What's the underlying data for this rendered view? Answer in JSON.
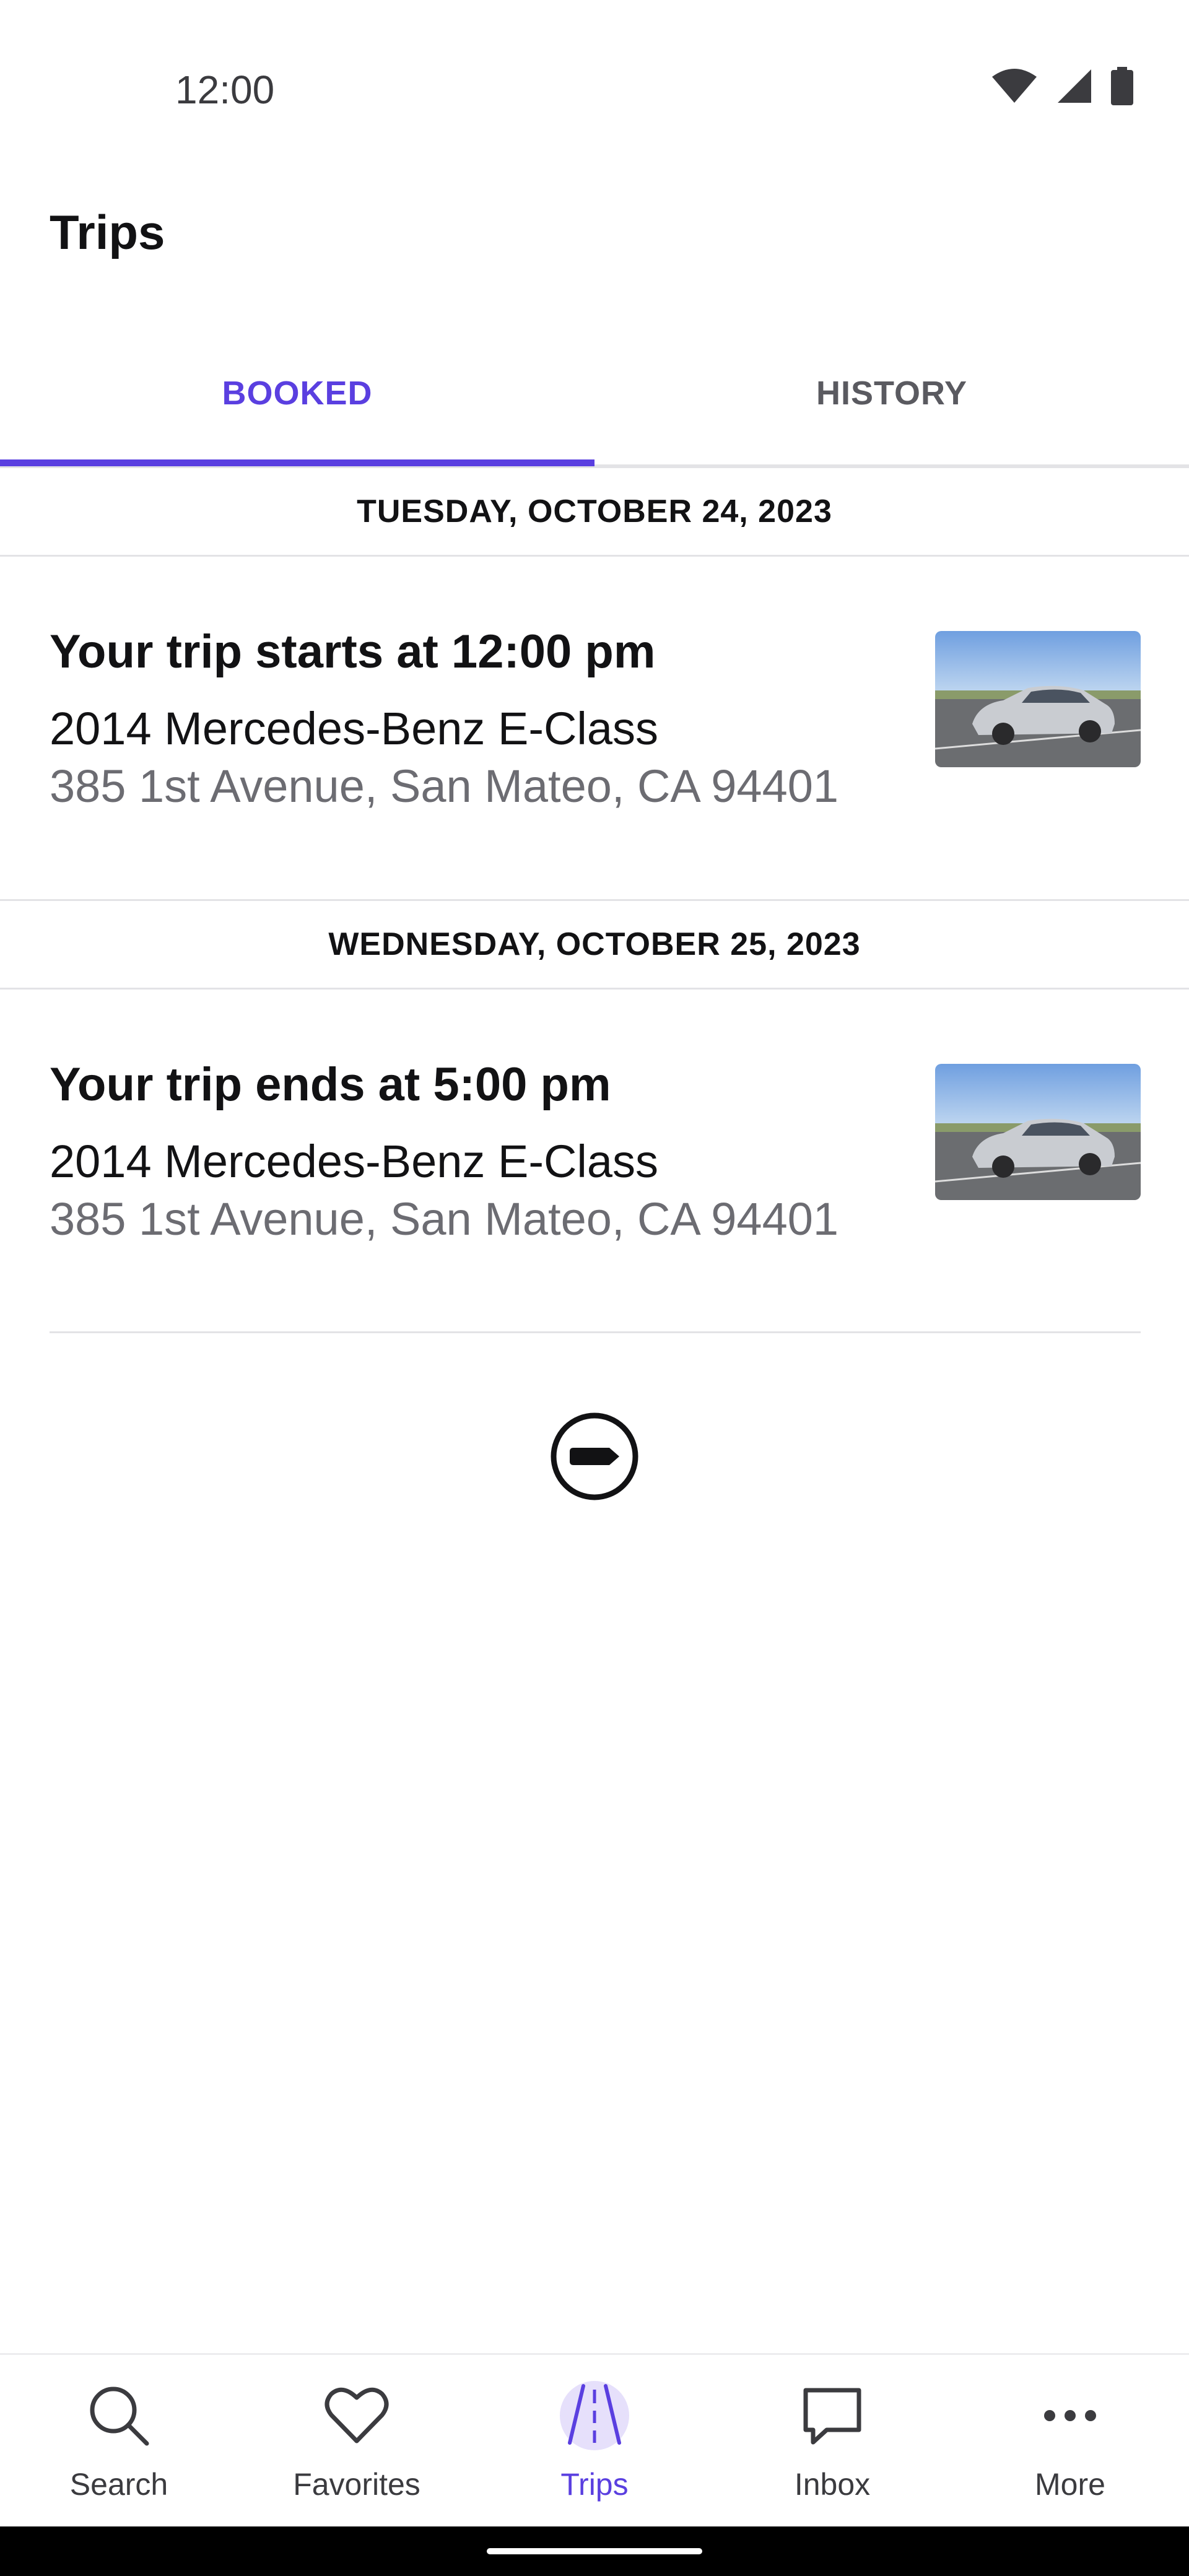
{
  "status_bar": {
    "time": "12:00"
  },
  "header": {
    "title": "Trips"
  },
  "tabs": [
    {
      "label": "BOOKED",
      "active": true
    },
    {
      "label": "HISTORY",
      "active": false
    }
  ],
  "trips": [
    {
      "date": "TUESDAY, OCTOBER 24, 2023",
      "title": "Your trip starts at 12:00 pm",
      "vehicle": "2014 Mercedes-Benz E-Class",
      "address": "385 1st Avenue, San Mateo, CA 94401"
    },
    {
      "date": "WEDNESDAY, OCTOBER 25, 2023",
      "title": "Your trip ends at 5:00 pm",
      "vehicle": "2014 Mercedes-Benz E-Class",
      "address": "385 1st Avenue, San Mateo, CA 94401"
    }
  ],
  "nav": [
    {
      "label": "Search",
      "icon": "search-icon"
    },
    {
      "label": "Favorites",
      "icon": "heart-icon"
    },
    {
      "label": "Trips",
      "icon": "road-icon",
      "active": true
    },
    {
      "label": "Inbox",
      "icon": "chat-icon"
    },
    {
      "label": "More",
      "icon": "more-icon"
    }
  ],
  "colors": {
    "accent": "#5a3fe0",
    "text": "#121214",
    "muted": "#6c6c72",
    "divider": "#e3e3e6"
  }
}
